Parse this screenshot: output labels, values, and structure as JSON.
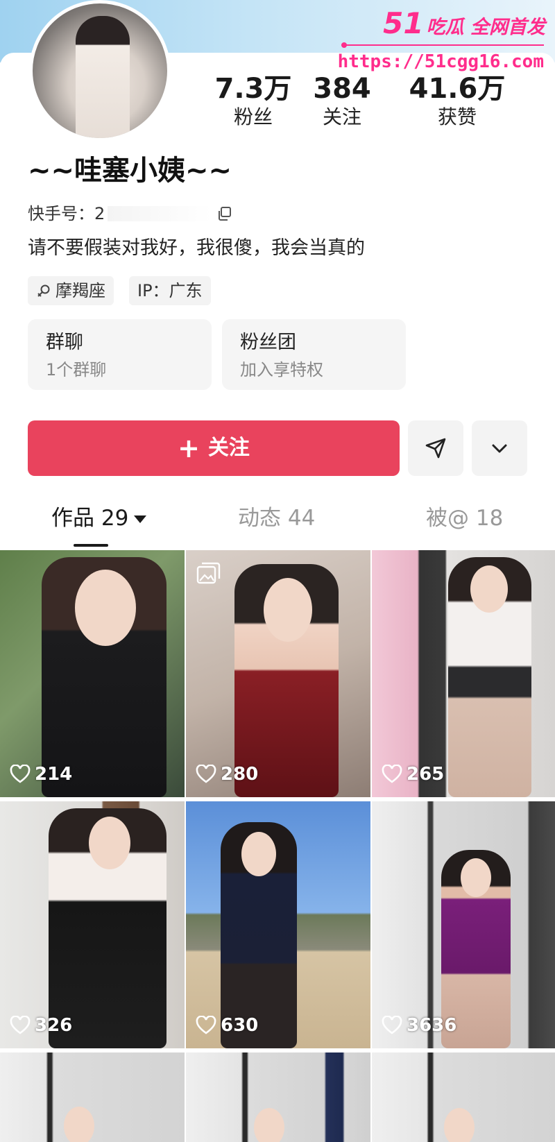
{
  "watermark": {
    "brand_number": "51",
    "brand_text": "吃瓜 全网首发",
    "url": "https://51cgg16.com"
  },
  "profile": {
    "stats": [
      {
        "value": "7.3万",
        "label": "粉丝"
      },
      {
        "value": "384",
        "label": "关注"
      },
      {
        "value": "41.6万",
        "label": "获赞"
      }
    ],
    "nickname": "~~哇塞小姨~~",
    "id_label": "快手号：2",
    "bio": "请不要假装对我好，我很傻，我会当真的",
    "tags": [
      {
        "icon": "zodiac-icon",
        "text": "摩羯座"
      },
      {
        "text": "IP：广东"
      }
    ],
    "cards": [
      {
        "title": "群聊",
        "subtitle": "1个群聊"
      },
      {
        "title": "粉丝团",
        "subtitle": "加入享特权"
      }
    ]
  },
  "actions": {
    "follow_label": "关注",
    "follow_icon": "plus-icon",
    "share_icon": "send-icon",
    "more_icon": "chevron-down-icon"
  },
  "tabs": [
    {
      "label": "作品 29",
      "active": true
    },
    {
      "label": "动态 44",
      "active": false
    },
    {
      "label": "被@ 18",
      "active": false
    }
  ],
  "works": [
    {
      "likes": "214"
    },
    {
      "likes": "280",
      "multi_image": true
    },
    {
      "likes": "265"
    },
    {
      "likes": "326"
    },
    {
      "likes": "630"
    },
    {
      "likes": "3636"
    },
    {},
    {},
    {}
  ],
  "colors": {
    "accent": "#e9435d",
    "watermark": "#ff2d8c",
    "banner": "#9fd2f0"
  }
}
